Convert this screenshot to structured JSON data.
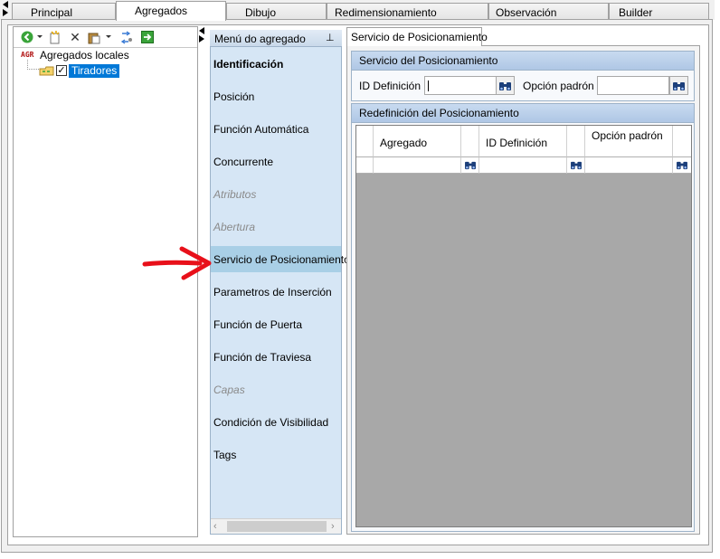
{
  "tabs": [
    {
      "label": "Principal"
    },
    {
      "label": "Agregados"
    },
    {
      "label": "Dibujo"
    },
    {
      "label": "Redimensionamiento"
    },
    {
      "label": "Observación"
    },
    {
      "label": "Builder"
    }
  ],
  "tree": {
    "toolbar_icons": [
      "back-circle-icon",
      "new-item-icon",
      "delete-icon",
      "paste-icon",
      "refresh-icon",
      "export-icon"
    ],
    "root_prefix": "AGR",
    "root_label": "Agregados locales",
    "child_label": "Tiradores",
    "child_checked": true
  },
  "menu": {
    "header": "Menú do agregado",
    "pin_icon": "pin-icon",
    "items": [
      {
        "label": "Identificación",
        "state": "bold"
      },
      {
        "label": "Posición",
        "state": "normal"
      },
      {
        "label": "Función Automática",
        "state": "normal"
      },
      {
        "label": "Concurrente",
        "state": "normal"
      },
      {
        "label": "Atributos",
        "state": "disabled"
      },
      {
        "label": "Abertura",
        "state": "disabled"
      },
      {
        "label": "Servicio de Posicionamiento",
        "state": "selected"
      },
      {
        "label": "Parametros de Inserción",
        "state": "normal"
      },
      {
        "label": "Función de Puerta",
        "state": "normal"
      },
      {
        "label": "Función de Traviesa",
        "state": "normal"
      },
      {
        "label": "Capas",
        "state": "disabled"
      },
      {
        "label": "Condición de Visibilidad",
        "state": "normal"
      },
      {
        "label": "Tags",
        "state": "normal"
      }
    ]
  },
  "right": {
    "tab_label": "Servicio de Posicionamiento",
    "group1": {
      "title": "Servicio del Posicionamiento",
      "id_label": "ID Definición",
      "id_value": "",
      "option_label": "Opción padrón",
      "option_value": ""
    },
    "group2": {
      "title": "Redefinición del Posicionamiento",
      "columns": [
        "Agregado",
        "ID Definición",
        "Opción padrón"
      ]
    }
  },
  "annotation": {
    "arrow_color": "#e8101a"
  },
  "colors": {
    "selection": "#0078d7",
    "menu_bg": "#d6e6f5",
    "menu_selected": "#a9cfe6",
    "grid_bg": "#a8a8a8"
  }
}
